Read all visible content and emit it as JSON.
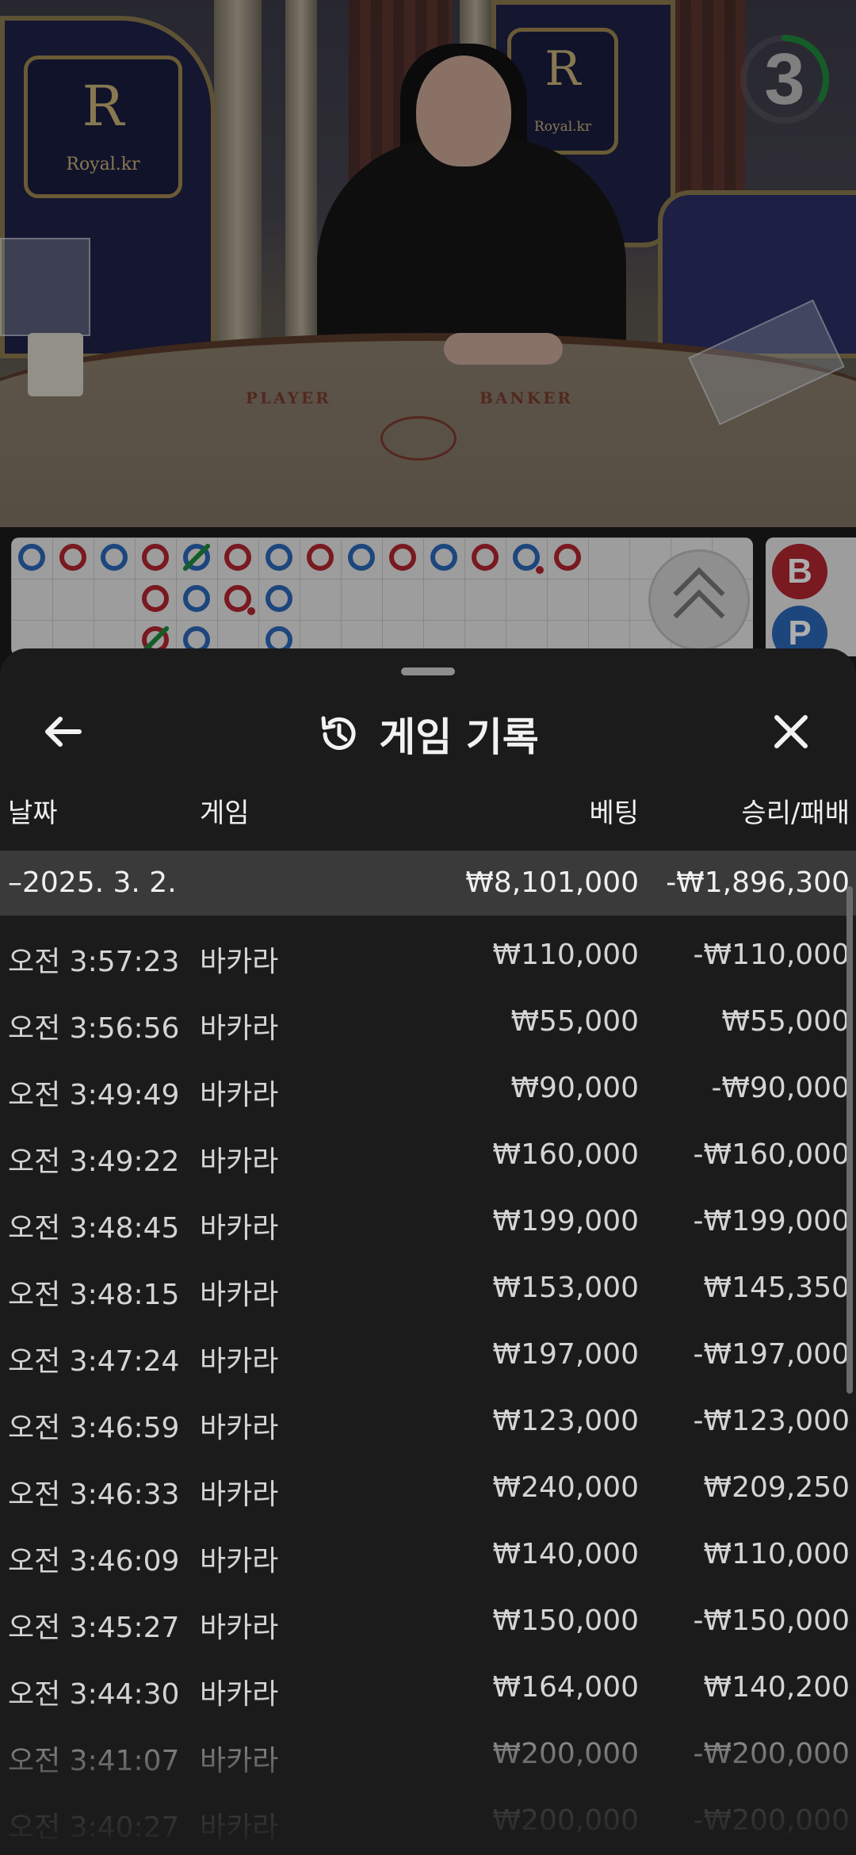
{
  "video": {
    "crest_left": {
      "letter": "R",
      "text": "Royal.kr"
    },
    "crest_center": {
      "letter": "R",
      "text": "Royal.kr"
    },
    "felt_player": "PLAYER",
    "felt_banker": "BANKER",
    "countdown": "3",
    "countdown_progress": 0.33
  },
  "scoreboard": {
    "bp_labels": [
      "B",
      "P"
    ]
  },
  "sheet": {
    "title": "게임 기록",
    "icons": {
      "back": "arrow-left-icon",
      "title": "history-icon",
      "close": "close-icon"
    },
    "columns": {
      "date": "날짜",
      "game": "게임",
      "bet": "베팅",
      "result": "승리/패배"
    },
    "summary": {
      "date": "–2025. 3. 2.",
      "bet": "₩8,101,000",
      "result": "-₩1,896,300"
    },
    "rows": [
      {
        "time": "오전 3:57:23",
        "game": "바카라",
        "bet": "₩110,000",
        "result": "-₩110,000"
      },
      {
        "time": "오전 3:56:56",
        "game": "바카라",
        "bet": "₩55,000",
        "result": "₩55,000"
      },
      {
        "time": "오전 3:49:49",
        "game": "바카라",
        "bet": "₩90,000",
        "result": "-₩90,000"
      },
      {
        "time": "오전 3:49:22",
        "game": "바카라",
        "bet": "₩160,000",
        "result": "-₩160,000"
      },
      {
        "time": "오전 3:48:45",
        "game": "바카라",
        "bet": "₩199,000",
        "result": "-₩199,000"
      },
      {
        "time": "오전 3:48:15",
        "game": "바카라",
        "bet": "₩153,000",
        "result": "₩145,350"
      },
      {
        "time": "오전 3:47:24",
        "game": "바카라",
        "bet": "₩197,000",
        "result": "-₩197,000"
      },
      {
        "time": "오전 3:46:59",
        "game": "바카라",
        "bet": "₩123,000",
        "result": "-₩123,000"
      },
      {
        "time": "오전 3:46:33",
        "game": "바카라",
        "bet": "₩240,000",
        "result": "₩209,250"
      },
      {
        "time": "오전 3:46:09",
        "game": "바카라",
        "bet": "₩140,000",
        "result": "₩110,000"
      },
      {
        "time": "오전 3:45:27",
        "game": "바카라",
        "bet": "₩150,000",
        "result": "-₩150,000"
      },
      {
        "time": "오전 3:44:30",
        "game": "바카라",
        "bet": "₩164,000",
        "result": "₩140,200"
      },
      {
        "time": "오전 3:41:07",
        "game": "바카라",
        "bet": "₩200,000",
        "result": "-₩200,000"
      },
      {
        "time": "오전 3:40:27",
        "game": "바카라",
        "bet": "₩200,000",
        "result": "-₩200,000"
      }
    ]
  }
}
